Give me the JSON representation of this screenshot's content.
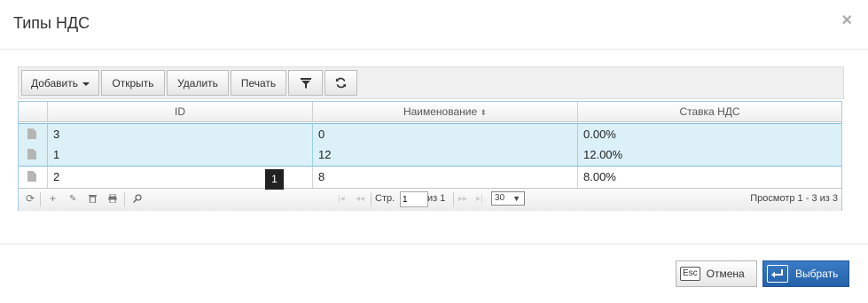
{
  "dialog": {
    "title": "Типы НДС",
    "close_glyph": "×"
  },
  "toolbar": {
    "add_label": "Добавить",
    "open_label": "Открыть",
    "delete_label": "Удалить",
    "print_label": "Печать",
    "filter_icon": "filter-icon",
    "refresh_icon": "refresh-icon"
  },
  "grid": {
    "columns": [
      "ID",
      "Наименование",
      "Ставка НДС"
    ],
    "sort_glyph": "⬍",
    "rows": [
      {
        "id": "3",
        "name": "0",
        "rate": "0.00%",
        "selected": true
      },
      {
        "id": "1",
        "name": "12",
        "rate": "12.00%",
        "selected": true
      },
      {
        "id": "2",
        "name": "8",
        "rate": "8.00%",
        "selected": false
      }
    ],
    "row_badge": "1"
  },
  "pager": {
    "page_label": "Стр.",
    "page_value": "1",
    "of_label": "из 1",
    "page_size": "30",
    "page_size_options": [
      "30"
    ],
    "view_text": "Просмотр 1 - 3 из 3"
  },
  "footer": {
    "cancel_key": "Esc",
    "cancel_label": "Отмена",
    "select_label": "Выбрать"
  },
  "colors": {
    "selected_row": "#dcf0f7",
    "primary_button": "#2a6bb3",
    "grid_border": "#a6c9e2"
  }
}
